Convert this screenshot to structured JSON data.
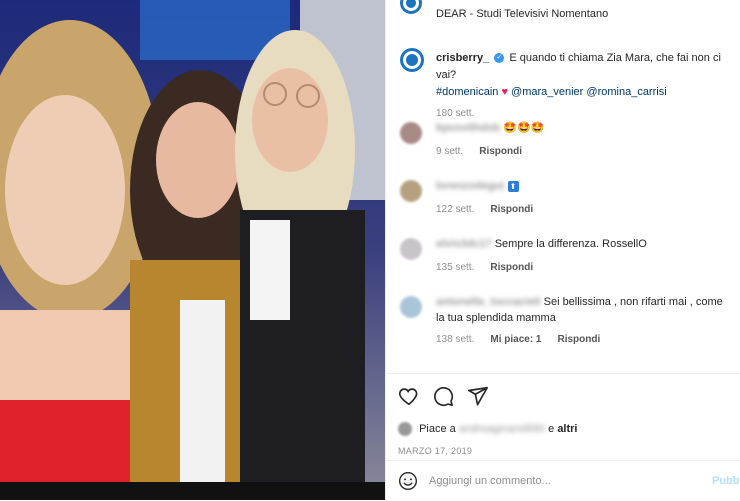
{
  "photo": {
    "alt_name": "selfie-photo"
  },
  "header": {
    "location": "DEAR - Studi Televisivi Nomentano"
  },
  "caption": {
    "username": "crisberry_",
    "verified": "✓",
    "text": "E quando ti chiama Zia Mara, che fai non ci vai?",
    "hashtag": "#domenicain",
    "mention1": "@mara_venier",
    "mention2": "@romina_carrisi",
    "time": "180 sett."
  },
  "comments": [
    {
      "user": "bpvsv0hdsb",
      "text": "🤩🤩🤩",
      "time": "9 sett.",
      "reply": "Rispondi",
      "likes": "",
      "avatar_color": "#a88a86"
    },
    {
      "user": "lorenzodegui",
      "text": "",
      "time": "122 sett.",
      "reply": "Rispondi",
      "likes": "",
      "avatar_color": "#b5a180"
    },
    {
      "user": "elvis3dc17",
      "text": "Sempre la differenza. RossellO",
      "time": "135 sett.",
      "reply": "Rispondi",
      "likes": "",
      "avatar_color": "#c9c4c9"
    },
    {
      "user": "antonella_toccacieli",
      "text": "Sei bellissima , non rifarti mai , come la tua splendida mamma",
      "time": "138 sett.",
      "reply": "Rispondi",
      "likes": "Mi piace: 1",
      "avatar_color": "#a9c6d8"
    }
  ],
  "likes": {
    "prefix": "Piace a",
    "user": "andreaginarsilli90",
    "middle": "e",
    "others": "altri"
  },
  "date": "MARZO 17, 2019",
  "add_comment": {
    "placeholder": "Aggiungi un commento...",
    "post": "Pubbli"
  }
}
